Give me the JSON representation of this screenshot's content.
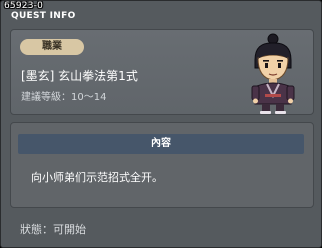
{
  "window": {
    "quest_id": "65923-0",
    "title": "QUEST INFO"
  },
  "quest": {
    "job_label": "職業",
    "name": "[墨玄] 玄山拳法第1式",
    "level_label": "建議等級：",
    "level_range": "10～14"
  },
  "content": {
    "header": "內容",
    "description": "向小师弟们示范招式全开。"
  },
  "status": {
    "label": "狀態：",
    "value": "可開始"
  },
  "colors": {
    "window_bg": "#555a5e",
    "job_badge": "#d8c7a4",
    "content_header": "#46566a"
  },
  "icons": {
    "character_portrait": "character-portrait-icon"
  }
}
